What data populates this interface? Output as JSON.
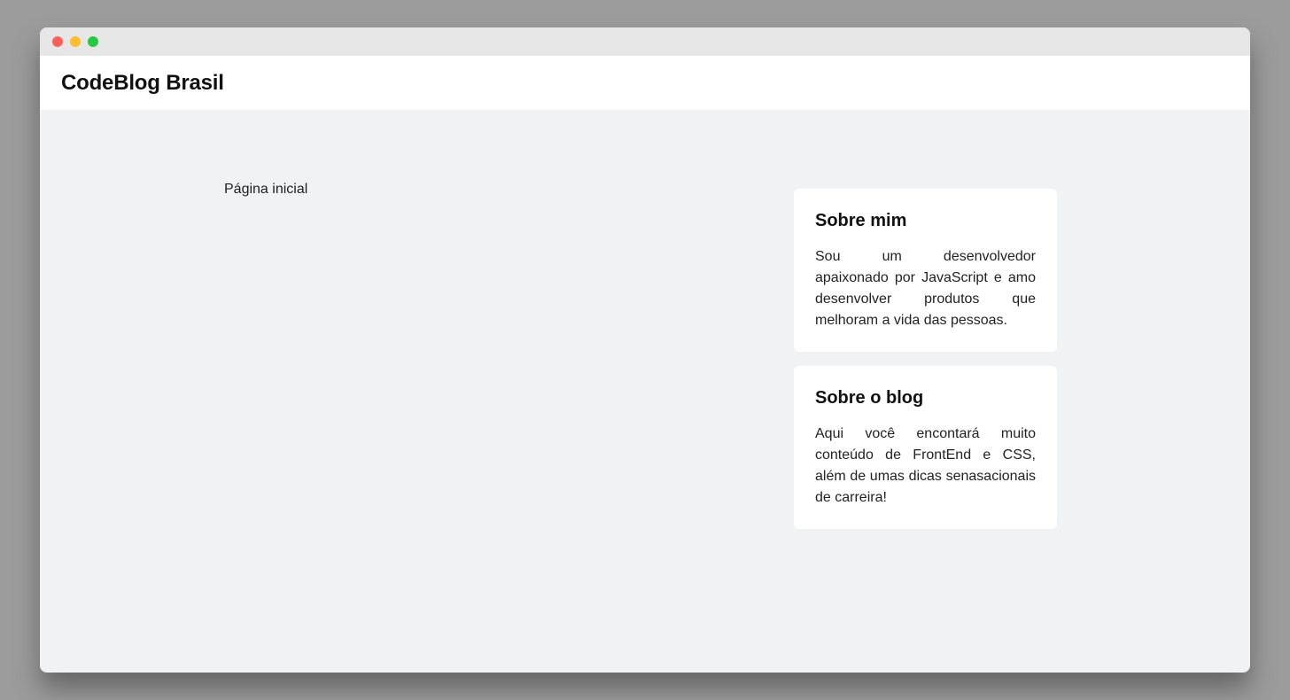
{
  "site": {
    "brand": "CodeBlog Brasil"
  },
  "main": {
    "breadcrumb": "Página inicial"
  },
  "sidebar": {
    "cards": [
      {
        "title": "Sobre mim",
        "text": "Sou um desenvolvedor apaixonado por JavaScript e amo desenvolver produtos que melhoram a vida das pessoas."
      },
      {
        "title": "Sobre o blog",
        "text": "Aqui você encontará muito conteúdo de FrontEnd e CSS, além de umas dicas senasacionais de carreira!"
      }
    ]
  },
  "colors": {
    "background": "#f1f2f4",
    "card": "#ffffff",
    "titlebar": "#e6e6e6",
    "traffic_red": "#ff5f57",
    "traffic_yellow": "#febc2e",
    "traffic_green": "#28c840"
  }
}
